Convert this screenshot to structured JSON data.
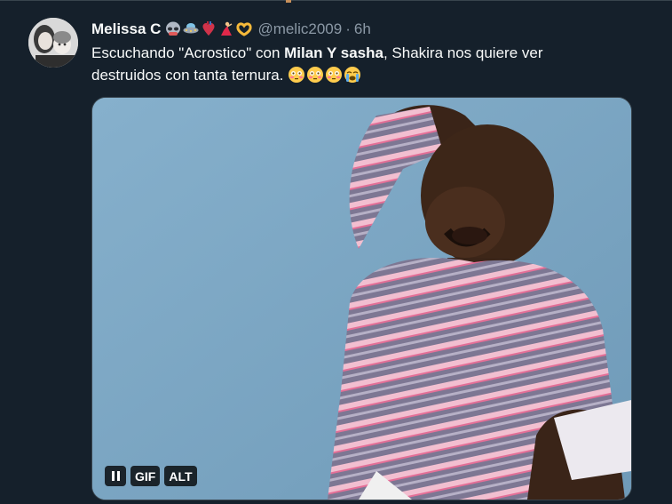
{
  "tweet": {
    "author_name": "Melissa C",
    "name_emojis": [
      "alien-icon",
      "ufo-icon",
      "anatomical-heart-icon",
      "dancer-icon",
      "heart-hands-icon"
    ],
    "handle": "@melic2009",
    "separator": "·",
    "time": "6h",
    "text_part1": "Escuchando \"Acrostico\" con ",
    "text_bold": "Milan Y sasha",
    "text_part2": ", Shakira nos quiere ver destruidos con tanta ternura.",
    "text_emojis": [
      "flushed-face-icon",
      "flushed-face-icon",
      "flushed-face-icon",
      "crying-face-icon"
    ]
  },
  "media": {
    "type": "GIF",
    "pause_label": "pause",
    "gif_label": "GIF",
    "alt_label": "ALT"
  },
  "colors": {
    "background": "#15202b",
    "text": "#f7f9f9",
    "muted": "#8b98a5",
    "border": "#38444d"
  }
}
